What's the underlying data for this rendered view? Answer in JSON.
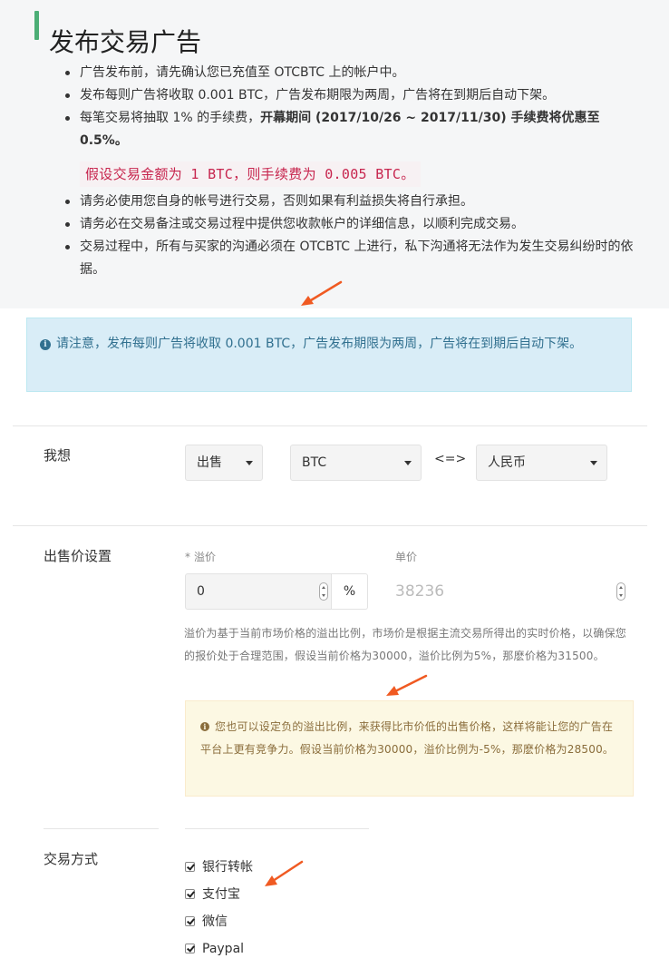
{
  "page": {
    "title": "发布交易广告"
  },
  "notes": {
    "item1": "广告发布前，请先确认您已充值至 OTCBTC 上的帐户中。",
    "item2": "发布每则广告将收取 0.001 BTC，广告发布期限为两周，广告将在到期后自动下架。",
    "item3_prefix": "每笔交易将抽取 1% 的手续费，",
    "item3_bold": "开幕期间 (2017/10/26 ~ 2017/11/30) 手续费将优惠至 0.5%。",
    "fee_example": "假设交易金额为 1 BTC，则手续费为 0.005 BTC。",
    "item4": "请务必使用您自身的帐号进行交易，否则如果有利益损失将自行承担。",
    "item5": "请务必在交易备注或交易过程中提供您收款帐户的详细信息，以顺利完成交易。",
    "item6": "交易过程中，所有与买家的沟通必须在 OTCBTC 上进行，私下沟通将无法作为发生交易纠纷时的依据。"
  },
  "info_alert": {
    "icon": "info-circle-icon",
    "text": "请注意，发布每则广告将收取 0.001 BTC，广告发布期限为两周，广告将在到期后自动下架。"
  },
  "want": {
    "label": "我想",
    "action_value": "出售",
    "coin_value": "BTC",
    "swap_text": "<=>",
    "currency_value": "人民币"
  },
  "price_settings": {
    "label": "出售价设置",
    "premium_label": "溢价",
    "required_mark": "*",
    "premium_value": "0",
    "percent_addon": "%",
    "unit_price_label": "单价",
    "unit_price_placeholder": "38236",
    "help_text": "溢价为基于当前市场价格的溢出比例，市场价是根据主流交易所得出的实时价格，以确保您的报价处于合理范围，假设当前价格为30000，溢价比例为5%，那麽价格为31500。",
    "warning_icon": "info-circle-icon",
    "warning_text": "您也可以设定负的溢出比例，来获得比市价低的出售价格，这样将能让您的广告在平台上更有竞争力。假设当前价格为30000，溢价比例为-5%，那麽价格为28500。"
  },
  "payment": {
    "label": "交易方式",
    "methods": [
      {
        "label": "银行转帐",
        "checked": true
      },
      {
        "label": "支付宝",
        "checked": true
      },
      {
        "label": "微信",
        "checked": true
      },
      {
        "label": "Paypal",
        "checked": true
      }
    ]
  },
  "colors": {
    "accent_green": "#4cae76",
    "highlight_red": "#c7254e",
    "arrow_orange": "#f05a22",
    "info_bg": "#d9edf7",
    "warning_bg": "#fcf8e3"
  }
}
